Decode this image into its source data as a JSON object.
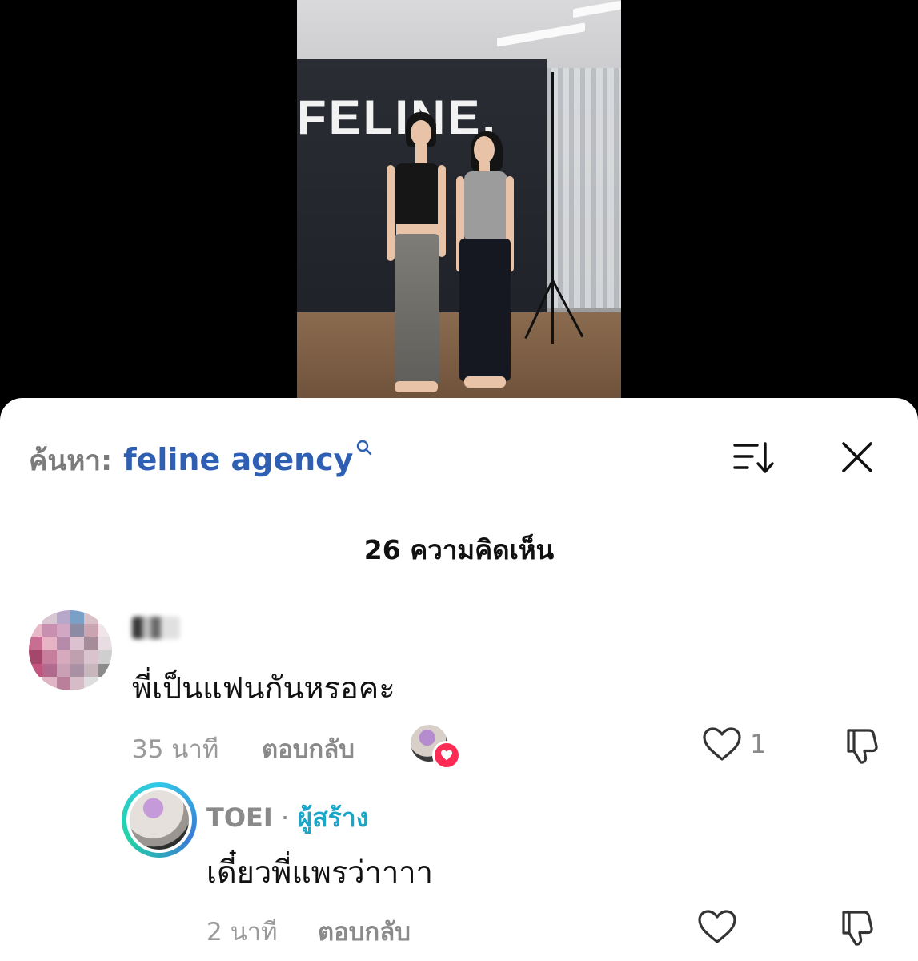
{
  "video": {
    "brand_text": "FELINE."
  },
  "search": {
    "prefix": "ค้นหา:",
    "term": "feline agency"
  },
  "comments_header": {
    "count_label": "26 ความคิดเห็น"
  },
  "comments": [
    {
      "text": "พี่เป็นแฟนกันหรอคะ",
      "time": "35 นาที",
      "reply_label": "ตอบกลับ",
      "like_count": "1",
      "liked_by_creator": true,
      "replies": [
        {
          "username": "TOEI",
          "separator": "·",
          "badge": "ผู้สร้าง",
          "text": "เดี๋ยวพี่แพรว่าาาา",
          "time": "2 นาที",
          "reply_label": "ตอบกลับ"
        }
      ]
    }
  ],
  "colors": {
    "accent_blue": "#2f5fb3",
    "creator_badge": "#19a6c9",
    "like_red": "#fe2c55"
  },
  "icons": [
    "search-icon",
    "sort-icon",
    "close-icon",
    "heart-icon",
    "dislike-icon"
  ]
}
